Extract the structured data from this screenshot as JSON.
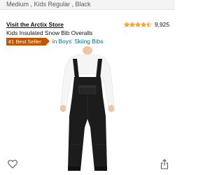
{
  "variant": {
    "text": "Medium , Kids Regular , Black"
  },
  "product": {
    "store_link": "Visit the Arctix Store",
    "title": "Kids Insulated Snow Bib Overalls",
    "rating_value": 4.5,
    "review_count": "9,925",
    "badge": "#1 Best Seller",
    "category": "in Boys' Skiing Bibs",
    "image_icon": "black-snow-bib-overalls"
  },
  "icons": {
    "star": "star-icon",
    "wishlist": "heart-icon",
    "share": "share-icon"
  },
  "colors": {
    "star": "#ffa41c",
    "badge": "#c45500",
    "link": "#007185",
    "garment": "#1a1a1a"
  }
}
